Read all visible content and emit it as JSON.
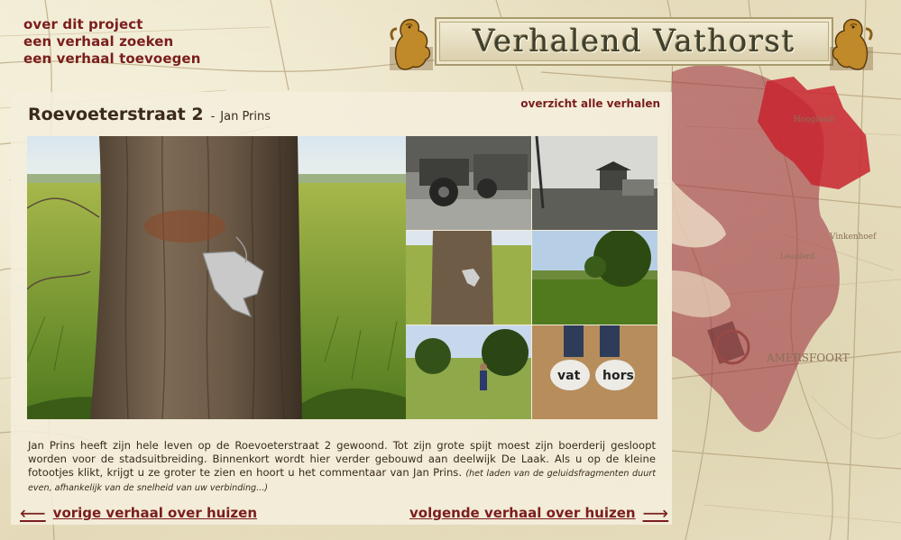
{
  "nav": {
    "items": [
      "over dit project",
      "een verhaal zoeken",
      "een verhaal toevoegen"
    ]
  },
  "banner": {
    "title": "Verhalend Vathorst"
  },
  "story": {
    "title": "Roevoeterstraat 2",
    "separator": "-",
    "author": "Jan Prins",
    "overview_link": "overzicht alle verhalen",
    "text": "Jan Prins heeft zijn hele leven op de Roevoeterstraat 2 gewoond. Tot zijn grote spijt moest zijn boerderij gesloopt worden voor de stadsuitbreiding. Binnenkort wordt hier verder gebouwd aan deelwijk De Laak. Als u op de kleine fotootjes klikt, krijgt u ze groter te zien en hoort u het commentaar van Jan Prins.",
    "note": "(het laden van de geluidsfragmenten duurt even, afhankelijk van de snelheid van uw verbinding...)"
  },
  "bottom_nav": {
    "prev_label": "vorige verhaal over huizen",
    "next_label": "volgende verhaal over huizen",
    "prev_arrow": "⟵",
    "next_arrow": "⟶"
  },
  "map": {
    "labels": [
      "Hoogland",
      "Vinkenhoef",
      "Leusderd",
      "AMERSFOORT"
    ]
  },
  "colors": {
    "link": "#7a1d1d",
    "text": "#3a2a1c",
    "map_region": "#9b2a3a",
    "map_highlight": "#c8242f"
  }
}
